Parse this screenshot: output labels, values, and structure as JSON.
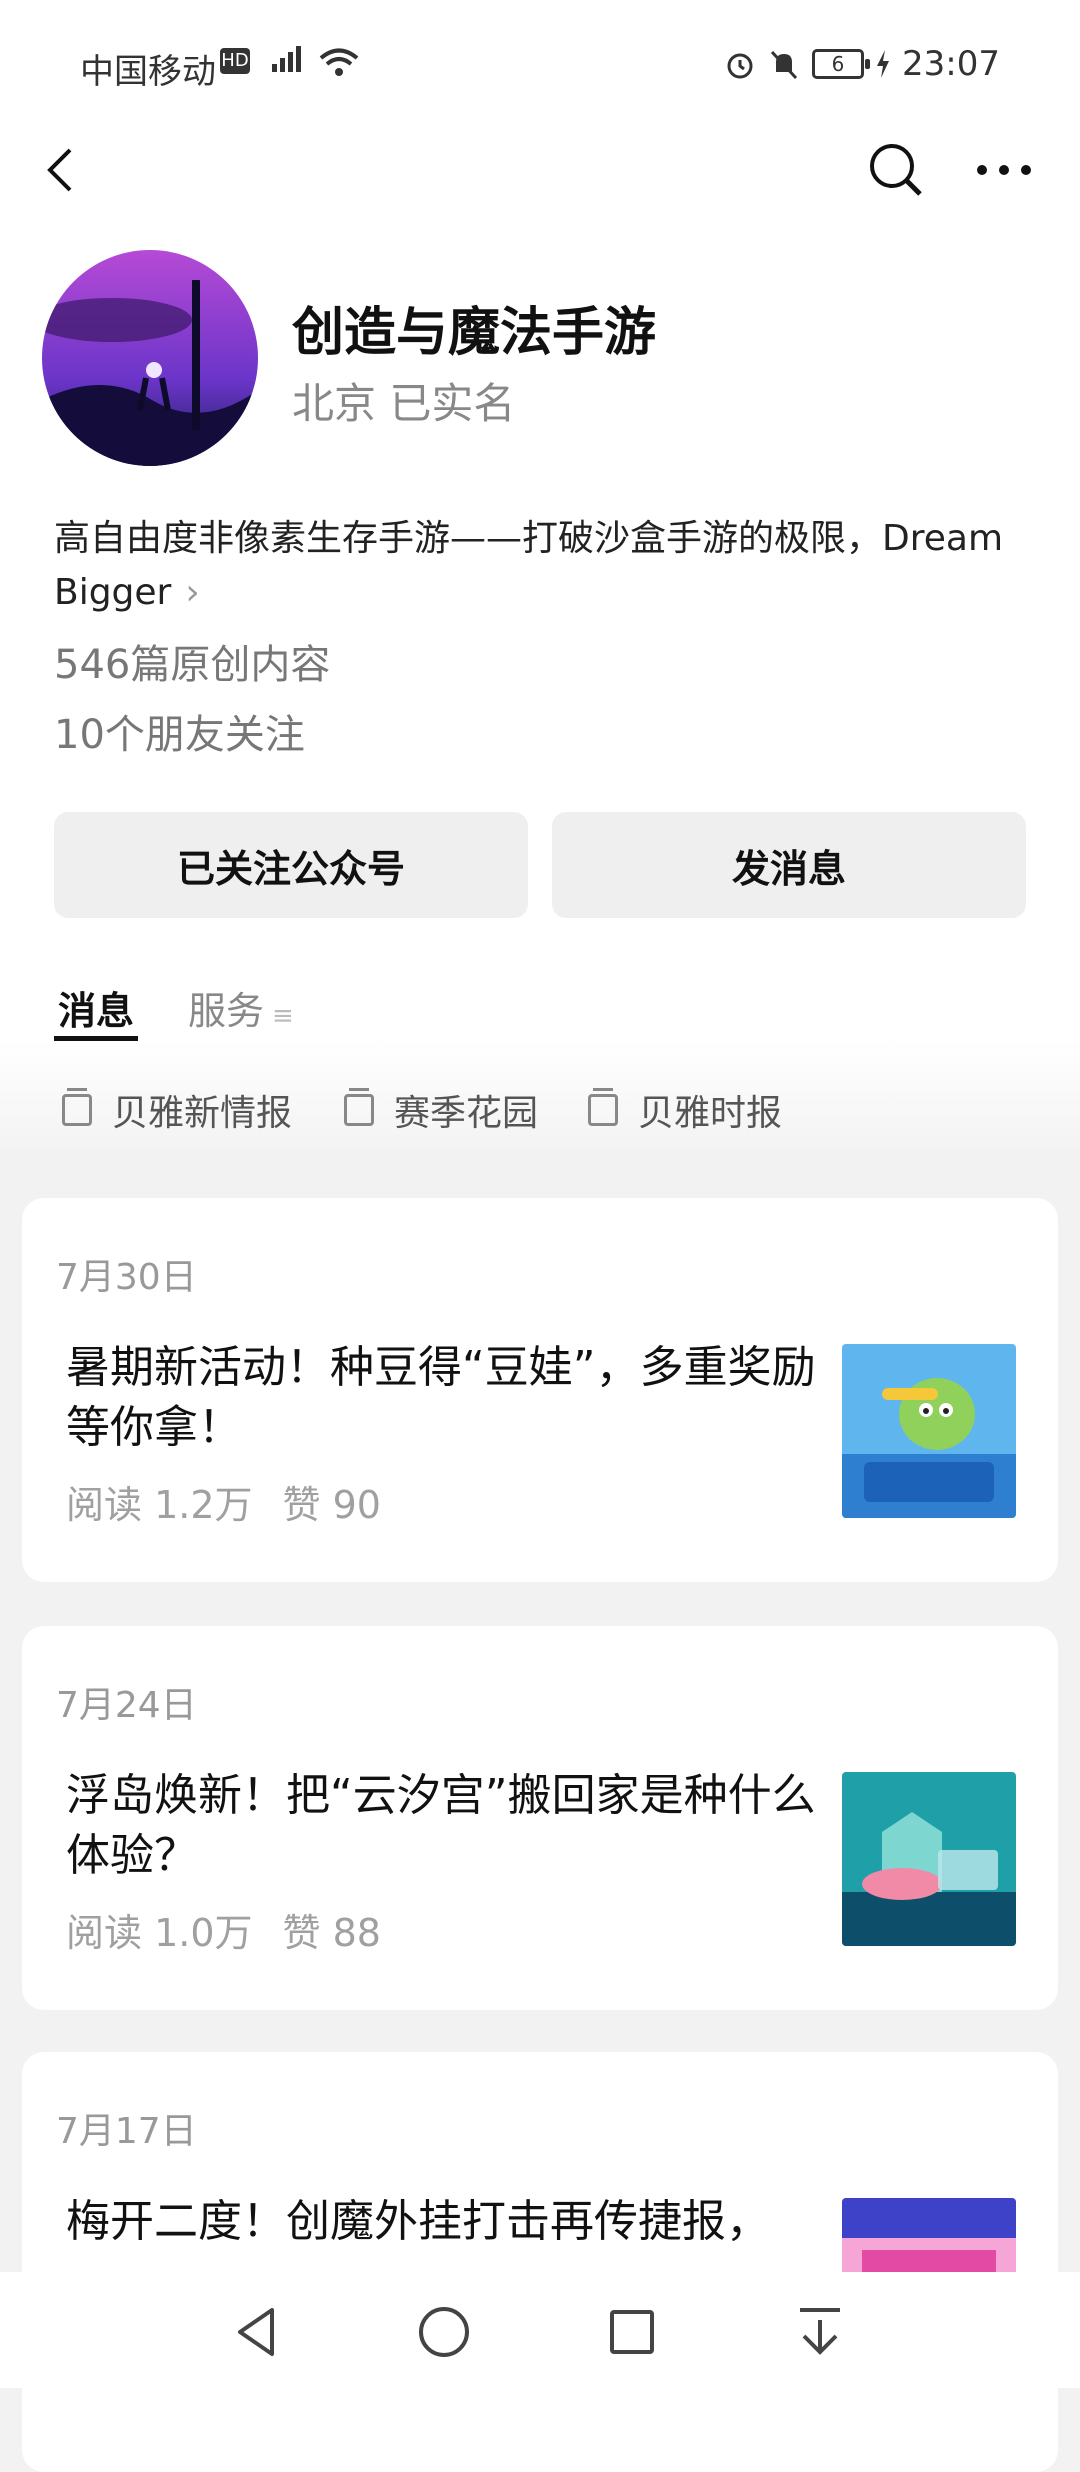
{
  "status_bar": {
    "carrier": "中国移动",
    "hd": "HD",
    "battery": "6",
    "time": "23:07"
  },
  "account": {
    "name": "创造与魔法手游",
    "meta": "北京 已实名",
    "description": "高自由度非像素生存手游——打破沙盒手游的极限，Dream Bigger",
    "original_count": "546篇原创内容",
    "friends_following": "10个朋友关注"
  },
  "buttons": {
    "follow": "已关注公众号",
    "message": "发消息"
  },
  "tabs": [
    {
      "label": "消息"
    },
    {
      "label": "服务"
    }
  ],
  "collections": [
    {
      "label": "贝雅新情报"
    },
    {
      "label": "赛季花园"
    },
    {
      "label": "贝雅时报"
    }
  ],
  "articles": [
    {
      "date": "7月30日",
      "title": "暑期新活动！种豆得“豆娃”，多重奖励等你拿！",
      "reads": "阅读 1.2万",
      "likes": "赞 90"
    },
    {
      "date": "7月24日",
      "title": "浮岛焕新！把“云汐宫”搬回家是种什么体验？",
      "reads": "阅读 1.0万",
      "likes": "赞 88"
    },
    {
      "date": "7月17日",
      "title": "梅开二度！创魔外挂打击再传捷报，"
    }
  ],
  "icons": [
    "back-icon",
    "search-icon",
    "more-icon",
    "chevron-right-icon",
    "collection-icon",
    "nav-back-icon",
    "nav-home-icon",
    "nav-recents-icon",
    "nav-download-icon"
  ],
  "colors": {
    "accent": "#111111",
    "muted": "#888888",
    "background": "#f2f2f2"
  }
}
